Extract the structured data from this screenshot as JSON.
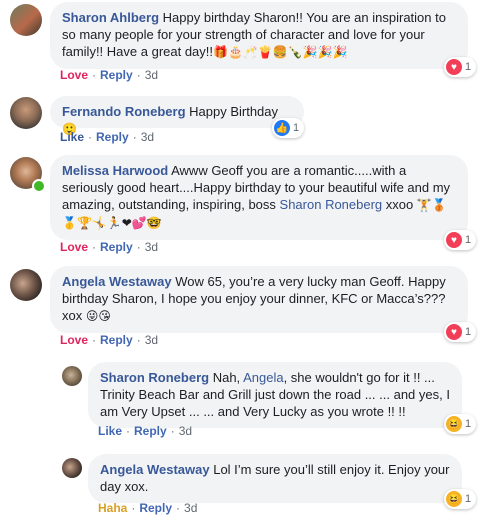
{
  "comments": [
    {
      "author": "Sharon Ahlberg",
      "text": "Happy birthday Sharon!! You are an inspiration to so many people for your strength of character and love for your family!! Have a great day!!",
      "emoji": "🎁🎂🥂🍟🍔🍾🎉🎉🎉",
      "action_react": "Love",
      "action_reply": "Reply",
      "time": "3d",
      "reaction_icon": "heart-icon",
      "reaction_count": "1"
    },
    {
      "author": "Fernando Roneberg",
      "text": "Happy Birthday",
      "emoji": "🙂",
      "action_react": "Like",
      "action_reply": "Reply",
      "time": "3d",
      "reaction_icon": "thumbs-up-icon",
      "reaction_count": "1"
    },
    {
      "author": "Melissa Harwood",
      "text_before": "Awww Geoff you are a romantic.....with a seriously good heart....Happy birthday to your beautiful wife and my amazing, outstanding, inspiring, boss",
      "mention": "Sharon Roneberg",
      "text_after": "xxoo",
      "emoji": "🏋🥉🥇🏆🤸🏃❤💕🤓",
      "action_react": "Love",
      "action_reply": "Reply",
      "time": "3d",
      "reaction_icon": "heart-icon",
      "reaction_count": "1"
    },
    {
      "author": "Angela Westaway",
      "text": "Wow 65, you’re a very lucky man Geoff. Happy birthday Sharon, I hope you enjoy your dinner, KFC or Macca’s??? xox",
      "emoji": "😜😘",
      "action_react": "Love",
      "action_reply": "Reply",
      "time": "3d",
      "reaction_icon": "heart-icon",
      "reaction_count": "1"
    }
  ],
  "replies": [
    {
      "author": "Sharon Roneberg",
      "text_before": "Nah,",
      "mention": "Angela",
      "text_after": ", she wouldn't go for it !! ... Trinity Beach Bar and Grill just down the road ... ... and yes, I am Very Upset ... ... and Very Lucky as you wrote !! !!",
      "action_react": "Like",
      "action_reply": "Reply",
      "time": "3d",
      "reaction_icon": "haha-icon",
      "reaction_count": "1"
    },
    {
      "author": "Angela Westaway",
      "text": "Lol I’m sure you’ll still enjoy it. Enjoy your day xox.",
      "action_react": "Haha",
      "action_reply": "Reply",
      "time": "3d",
      "reaction_icon": "haha-icon",
      "reaction_count": "1"
    }
  ],
  "separator": "·",
  "colors": {
    "author": "#385898",
    "love": "#e0245e",
    "haha": "#d9a024",
    "bubble": "#f2f3f5",
    "heart": "#f33e58",
    "thumb": "#2078f4"
  }
}
